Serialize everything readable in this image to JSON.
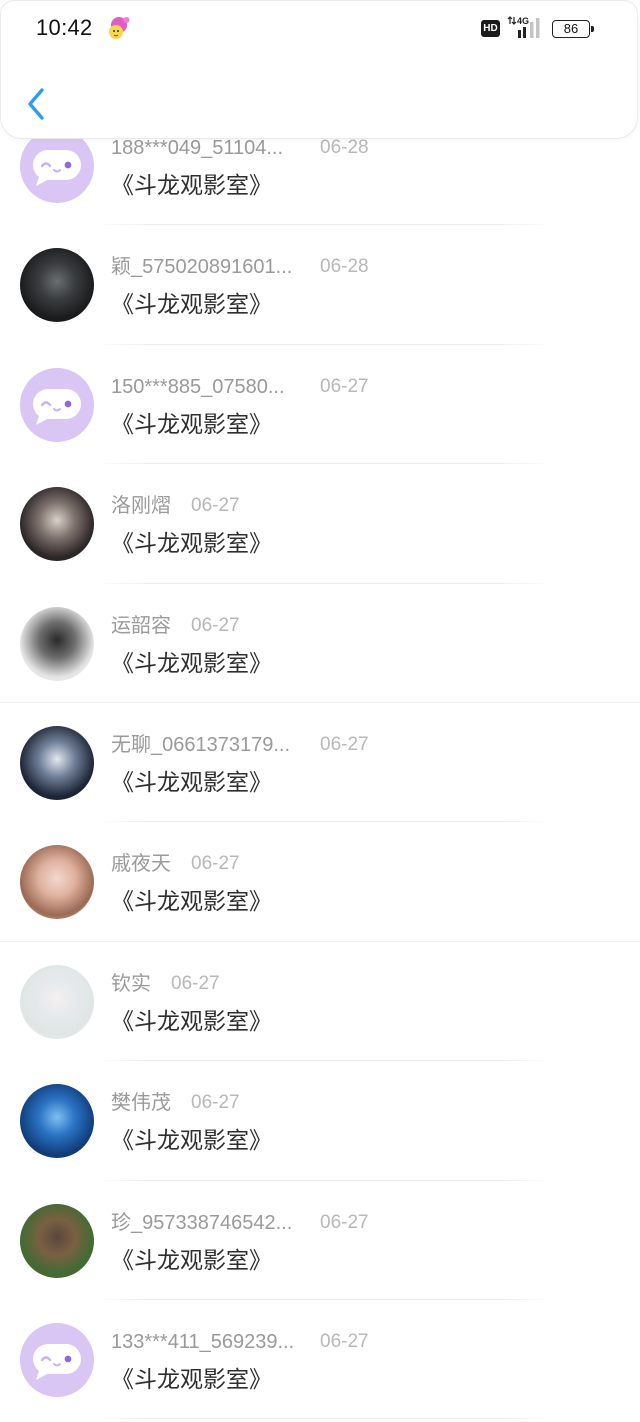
{
  "status_bar": {
    "time": "10:42",
    "notification_icon": "cartoon-face-icon",
    "hd_label": "HD",
    "network_label": "4G",
    "signal_icon": "signal-icon",
    "battery_icon": "battery-icon",
    "battery_level": "86"
  },
  "header": {
    "back_icon": "chevron-left-icon"
  },
  "colors": {
    "accent": "#2b9ef0",
    "name_text": "#9a9a9a",
    "date_text": "#b8b8b8",
    "title_text": "#2f2f2f",
    "default_avatar_bg": "#d9c6f4",
    "default_avatar_eye": "#8f6ad8",
    "default_avatar_line": "#c9b2ef"
  },
  "list": {
    "items": [
      {
        "name": "188***049_51104...",
        "date": "06-28",
        "title": "《斗龙观影室》",
        "avatar": {
          "icon": "chat-face-icon"
        }
      },
      {
        "name": "颖_575020891601...",
        "date": "06-28",
        "title": "《斗龙观影室》",
        "avatar": {
          "colors": [
            "#6a6e70",
            "#3a3d3f",
            "#1b1c1d",
            "#0f1010"
          ]
        }
      },
      {
        "name": "150***885_07580...",
        "date": "06-27",
        "title": "《斗龙观影室》",
        "avatar": {
          "icon": "chat-face-icon"
        }
      },
      {
        "name": "洛刚熠",
        "date": "06-27",
        "title": "《斗龙观影室》",
        "avatar": {
          "colors": [
            "#d9d0c9",
            "#7d716c",
            "#2e2729",
            "#1c1718"
          ]
        }
      },
      {
        "name": "运韶容",
        "date": "06-27",
        "title": "《斗龙观影室》",
        "avatar": {
          "colors": [
            "#2a2a2a",
            "#6e6e6e",
            "#e4e4e4",
            "#f4f4f4"
          ]
        }
      },
      {
        "name": "无聊_0661373179...",
        "date": "06-27",
        "title": "《斗龙观影室》",
        "avatar": {
          "colors": [
            "#e3e8f0",
            "#6f7e96",
            "#1f2738",
            "#0a0d14"
          ]
        }
      },
      {
        "name": "戚夜天",
        "date": "06-27",
        "title": "《斗龙观影室》",
        "avatar": {
          "colors": [
            "#f4d8cc",
            "#dfb29f",
            "#9b6a55",
            "#e9c7b9"
          ]
        }
      },
      {
        "name": "钦实",
        "date": "06-27",
        "title": "《斗龙观影室》",
        "avatar": {
          "colors": [
            "#f5f1ef",
            "#e6e9ed",
            "#dfe6e4",
            "#f0f3f2"
          ]
        }
      },
      {
        "name": "樊伟茂",
        "date": "06-27",
        "title": "《斗龙观影室》",
        "avatar": {
          "colors": [
            "#7fc0f0",
            "#2b73c4",
            "#123f7d",
            "#0a2550"
          ]
        }
      },
      {
        "name": "珍_957338746542...",
        "date": "06-27",
        "title": "《斗龙观影室》",
        "avatar": {
          "colors": [
            "#5a463e",
            "#7a6042",
            "#3f6b34",
            "#9a3c2c"
          ]
        }
      },
      {
        "name": "133***411_569239...",
        "date": "06-27",
        "title": "《斗龙观影室》",
        "avatar": {
          "icon": "chat-face-icon"
        }
      }
    ]
  }
}
